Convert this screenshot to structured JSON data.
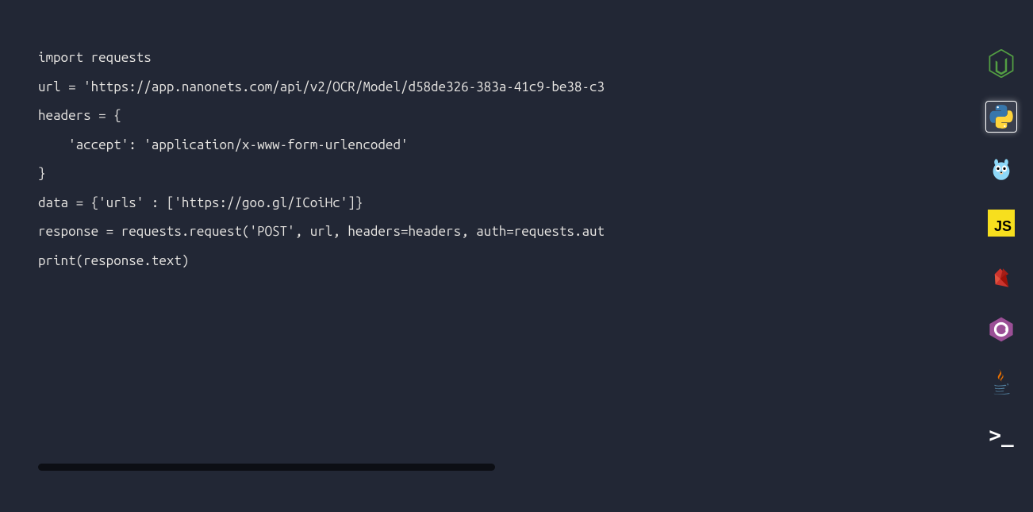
{
  "code": {
    "line1": "import requests",
    "line2": "",
    "line3": "url = 'https://app.nanonets.com/api/v2/OCR/Model/d58de326-383a-41c9-be38-c3",
    "line4": "",
    "line5": "headers = {",
    "line6": "    'accept': 'application/x-www-form-urlencoded'",
    "line7": "}",
    "line8": "",
    "line9": "data = {'urls' : ['https://goo.gl/ICoiHc']}",
    "line10": "",
    "line11": "response = requests.request('POST', url, headers=headers, auth=requests.aut",
    "line12": "",
    "line13": "print(response.text)"
  },
  "sidebar": {
    "languages": [
      {
        "name": "nodejs",
        "active": false
      },
      {
        "name": "python",
        "active": true
      },
      {
        "name": "golang",
        "active": false
      },
      {
        "name": "javascript",
        "active": false,
        "label": "JS"
      },
      {
        "name": "ruby",
        "active": false
      },
      {
        "name": "csharp",
        "active": false
      },
      {
        "name": "java",
        "active": false
      },
      {
        "name": "shell",
        "active": false,
        "label": ">_"
      }
    ]
  }
}
